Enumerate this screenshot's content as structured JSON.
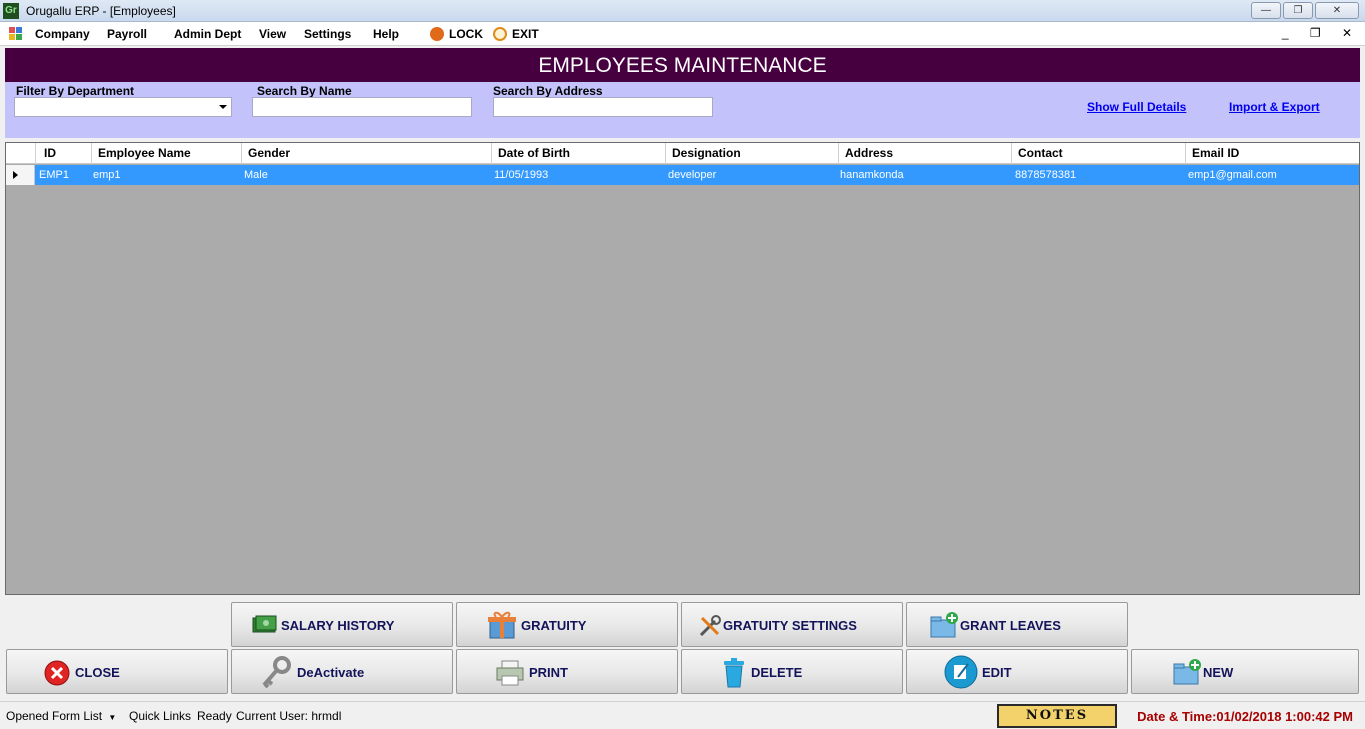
{
  "window": {
    "app_icon": "Gr",
    "title": "Orugallu ERP - [Employees]",
    "controls": {
      "minimize": "—",
      "restore": "❐",
      "close": "✕"
    }
  },
  "menu": {
    "items": [
      "Company",
      "Payroll",
      "Admin Dept",
      "View",
      "Settings",
      "Help"
    ],
    "lock": "LOCK",
    "exit": "EXIT",
    "mdi_controls": "_ ❐ ✕"
  },
  "header": {
    "title": "EMPLOYEES MAINTENANCE"
  },
  "filters": {
    "department_label": "Filter By Department",
    "department_value": "",
    "name_label": "Search By Name",
    "name_value": "",
    "address_label": "Search By Address",
    "address_value": "",
    "show_full_details": "Show Full Details",
    "import_export": "Import & Export"
  },
  "grid": {
    "columns": [
      "ID",
      "Employee Name",
      "Gender",
      "Date of Birth",
      "Designation",
      "Address",
      "Contact",
      "Email ID"
    ],
    "rows": [
      [
        "EMP1",
        "emp1",
        "Male",
        "11/05/1993",
        "developer",
        "hanamkonda",
        "8878578381",
        "emp1@gmail.com"
      ]
    ]
  },
  "buttons": {
    "salary_history": "SALARY HISTORY",
    "gratuity": "GRATUITY",
    "gratuity_settings": "GRATUITY SETTINGS",
    "grant_leaves": "GRANT LEAVES",
    "close": "CLOSE",
    "deactivate": "DeActivate",
    "print": "PRINT",
    "delete": "DELETE",
    "edit": "EDIT",
    "new": "NEW"
  },
  "status": {
    "opened_form_list": "Opened Form List",
    "quick_links": "Quick Links",
    "ready": "Ready",
    "current_user": "Current User: hrmdl",
    "notes": "NOTES",
    "datetime": "Date & Time:01/02/2018 1:00:42 PM"
  },
  "colors": {
    "header_bg": "#460040",
    "filter_bg": "#c4c2fb",
    "selected_row": "#3399ff",
    "grid_bg": "#ababab",
    "datetime": "#a80000"
  }
}
